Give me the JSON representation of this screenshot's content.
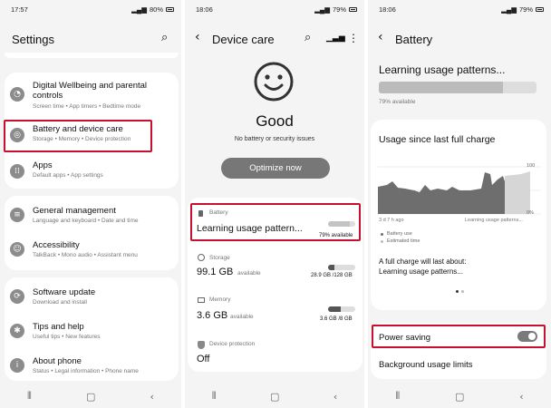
{
  "screen1": {
    "time": "17:57",
    "battery": "80%",
    "title": "Settings",
    "items": [
      {
        "title": "Digital Wellbeing and parental controls",
        "sub": "Screen time • App timers • Bedtime mode"
      },
      {
        "title": "Battery and device care",
        "sub": "Storage • Memory • Device protection"
      },
      {
        "title": "Apps",
        "sub": "Default apps • App settings"
      },
      {
        "title": "General management",
        "sub": "Language and keyboard • Date and time"
      },
      {
        "title": "Accessibility",
        "sub": "TalkBack • Mono audio • Assistant menu"
      },
      {
        "title": "Software update",
        "sub": "Download and install"
      },
      {
        "title": "Tips and help",
        "sub": "Useful tips • New features"
      },
      {
        "title": "About phone",
        "sub": "Status • Legal information • Phone name"
      }
    ]
  },
  "screen2": {
    "time": "18:06",
    "battery": "79%",
    "title": "Device care",
    "status_text": "Good",
    "status_sub": "No battery or security issues",
    "optimize_label": "Optimize now",
    "battery_label": "Battery",
    "battery_value": "Learning usage pattern...",
    "battery_available": "79% available",
    "battery_level": 0.79,
    "storage_label": "Storage",
    "storage_value": "99.1 GB",
    "storage_unit": "available",
    "storage_detail": "28.9 GB /128 GB",
    "storage_used": 0.23,
    "memory_label": "Memory",
    "memory_value": "3.6 GB",
    "memory_unit": "available",
    "memory_detail": "3.6 GB /8 GB",
    "memory_used": 0.45,
    "protection_label": "Device protection",
    "protection_value": "Off"
  },
  "screen3": {
    "time": "18:06",
    "battery": "79%",
    "title": "Battery",
    "learning": "Learning usage patterns...",
    "available": "79% available",
    "battery_level": 0.79,
    "usage_title": "Usage since last full charge",
    "y_top": "100",
    "y_bottom": "0%",
    "x_left": "3 d 7 h ago",
    "x_right": "Learning usage patterns...",
    "legend_battery": "Battery use",
    "legend_estimated": "Estimated time",
    "full_charge_label": "A full charge will last about:",
    "full_charge_value": "Learning usage patterns...",
    "power_saving": "Power saving",
    "background_limits": "Background usage limits",
    "accent": "#c8102e"
  }
}
